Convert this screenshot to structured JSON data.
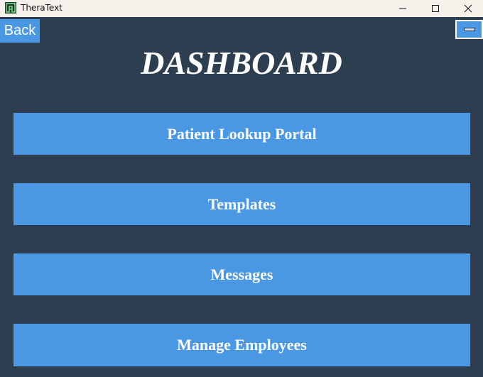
{
  "window": {
    "title": "TheraText",
    "controls": [
      "minimize",
      "maximize",
      "close"
    ]
  },
  "header": {
    "back_label": "Back",
    "title": "DASHBOARD"
  },
  "menu": [
    {
      "label": "Patient Lookup Portal"
    },
    {
      "label": "Templates"
    },
    {
      "label": "Messages"
    },
    {
      "label": "Manage Employees"
    }
  ],
  "colors": {
    "background": "#2c3e50",
    "button": "#4a98e3",
    "text": "#ffffff",
    "titlebar": "#f5f0ea"
  }
}
